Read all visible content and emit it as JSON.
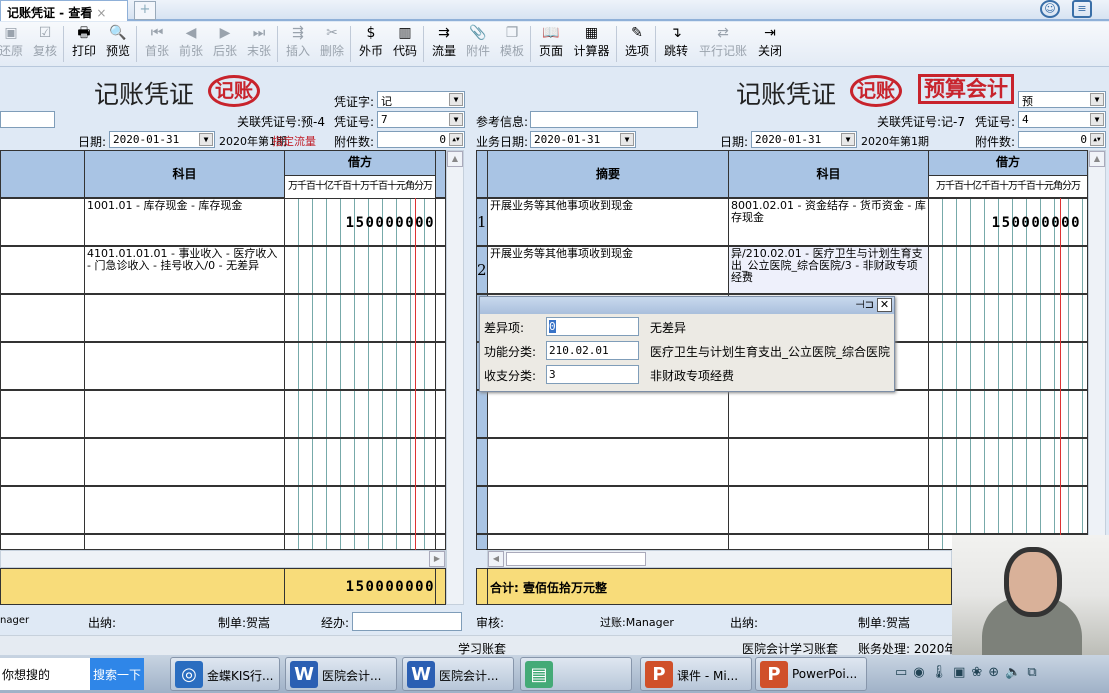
{
  "tab": {
    "title": "记账凭证 - 查看",
    "close": "×",
    "new": "+"
  },
  "toolbar": [
    {
      "label": "还原",
      "icon": "restore-icon",
      "glyph": "▣",
      "enabled": false
    },
    {
      "label": "复核",
      "icon": "review-icon",
      "glyph": "☑",
      "enabled": false
    },
    {
      "label": "打印",
      "icon": "printer-icon",
      "glyph": "🖶",
      "enabled": true
    },
    {
      "label": "预览",
      "icon": "preview-icon",
      "glyph": "🔍",
      "enabled": true
    },
    {
      "label": "首张",
      "icon": "first-icon",
      "glyph": "⏮",
      "enabled": false
    },
    {
      "label": "前张",
      "icon": "prev-icon",
      "glyph": "◀",
      "enabled": false
    },
    {
      "label": "后张",
      "icon": "next-icon",
      "glyph": "▶",
      "enabled": false
    },
    {
      "label": "末张",
      "icon": "last-icon",
      "glyph": "⏭",
      "enabled": false
    },
    {
      "label": "插入",
      "icon": "insert-icon",
      "glyph": "⇶",
      "enabled": false
    },
    {
      "label": "删除",
      "icon": "delete-icon",
      "glyph": "✂",
      "enabled": false
    },
    {
      "label": "外币",
      "icon": "currency-icon",
      "glyph": "$",
      "enabled": true
    },
    {
      "label": "代码",
      "icon": "code-icon",
      "glyph": "▥",
      "enabled": true
    },
    {
      "label": "流量",
      "icon": "flow-icon",
      "glyph": "⇉",
      "enabled": true
    },
    {
      "label": "附件",
      "icon": "attachment-icon",
      "glyph": "📎",
      "enabled": false
    },
    {
      "label": "模板",
      "icon": "template-icon",
      "glyph": "❐",
      "enabled": false
    },
    {
      "label": "页面",
      "icon": "page-icon",
      "glyph": "📖",
      "enabled": true
    },
    {
      "label": "计算器",
      "icon": "calculator-icon",
      "glyph": "▦",
      "enabled": true
    },
    {
      "label": "选项",
      "icon": "options-icon",
      "glyph": "✎",
      "enabled": true
    },
    {
      "label": "跳转",
      "icon": "jump-icon",
      "glyph": "↴",
      "enabled": true
    },
    {
      "label": "平行记账",
      "icon": "parallel-icon",
      "glyph": "⇄",
      "enabled": false
    },
    {
      "label": "关闭",
      "icon": "exit-icon",
      "glyph": "⇥",
      "enabled": true
    }
  ],
  "left": {
    "title": "记账凭证",
    "stamp": "记账",
    "voucher_type_label": "凭证字:",
    "voucher_type": "记",
    "related_label": "关联凭证号:预-4",
    "number_label": "凭证号:",
    "number": "7",
    "date_label": "日期:",
    "date": "2020-01-31",
    "period": "2020年第1期",
    "period_overlay": "指定流量",
    "attach_label": "附件数:",
    "attach": "0",
    "headers": {
      "subject": "科目",
      "debit": "借方",
      "units": "万千百十亿千百十万千百十元角分万"
    },
    "rows": [
      {
        "subject": "1001.01 - 库存现金 - 库存现金",
        "debit": "150000000"
      },
      {
        "subject": "4101.01.01.01 - 事业收入 - 医疗收入 - 门急诊收入 - 挂号收入/0 - 无差异",
        "debit": ""
      }
    ],
    "total": "150000000",
    "footer": {
      "poster": "nager",
      "cashier": "出纳:",
      "maker": "制单:贺嵩",
      "handler": "经办:"
    }
  },
  "right": {
    "title": "记账凭证",
    "stamp": "记账",
    "stamp2": "预算会计",
    "voucher_type": "预",
    "ref_label": "参考信息:",
    "biz_date_label": "业务日期:",
    "biz_date": "2020-01-31",
    "related_label": "关联凭证号:记-7",
    "number_label": "凭证号:",
    "number": "4",
    "date_label": "日期:",
    "date": "2020-01-31",
    "period": "2020年第1期",
    "attach_label": "附件数:",
    "attach": "0",
    "headers": {
      "summary": "摘要",
      "subject": "科目",
      "debit": "借方",
      "units": "万千百十亿千百十万千百十元角分万"
    },
    "rows": [
      {
        "no": "1",
        "summary": "开展业务等其他事项收到现金",
        "subject": "8001.02.01 - 资金结存 - 货币资金 - 库存现金",
        "debit": "150000000"
      },
      {
        "no": "2",
        "summary": "开展业务等其他事项收到现金",
        "subject": "异/210.02.01 - 医疗卫生与计划生育支出_公立医院_综合医院/3 - 非财政专项经费",
        "debit": ""
      }
    ],
    "total_label": "合计: 壹佰伍拾万元整",
    "footer": {
      "reviewer": "审核:",
      "poster": "过账:Manager",
      "cashier": "出纳:",
      "maker": "制单:贺嵩"
    }
  },
  "popup": {
    "fields": [
      {
        "label": "差异项:",
        "value": "0",
        "desc": "无差异"
      },
      {
        "label": "功能分类:",
        "value": "210.02.01",
        "desc": "医疗卫生与计划生育支出_公立医院_综合医院"
      },
      {
        "label": "收支分类:",
        "value": "3",
        "desc": "非财政专项经费"
      }
    ]
  },
  "status": {
    "book": "学习账套",
    "company": "医院会计学习账套",
    "process": "账务处理: 2020年"
  },
  "taskbar": {
    "search_placeholder": "你想搜的",
    "search_btn": "搜索一下",
    "tasks": [
      {
        "label": "金蝶KIS行...",
        "color": "#2a6dc0",
        "glyph": "◎"
      },
      {
        "label": "医院会计...",
        "color": "#2b5fb3",
        "glyph": "W"
      },
      {
        "label": "医院会计...",
        "color": "#2b5fb3",
        "glyph": "W"
      },
      {
        "label": "",
        "color": "#4a7",
        "glyph": "▤"
      },
      {
        "label": "课件 - Mi...",
        "color": "#d0502a",
        "glyph": "P"
      },
      {
        "label": "PowerPoi...",
        "color": "#d0502a",
        "glyph": "P"
      }
    ]
  }
}
